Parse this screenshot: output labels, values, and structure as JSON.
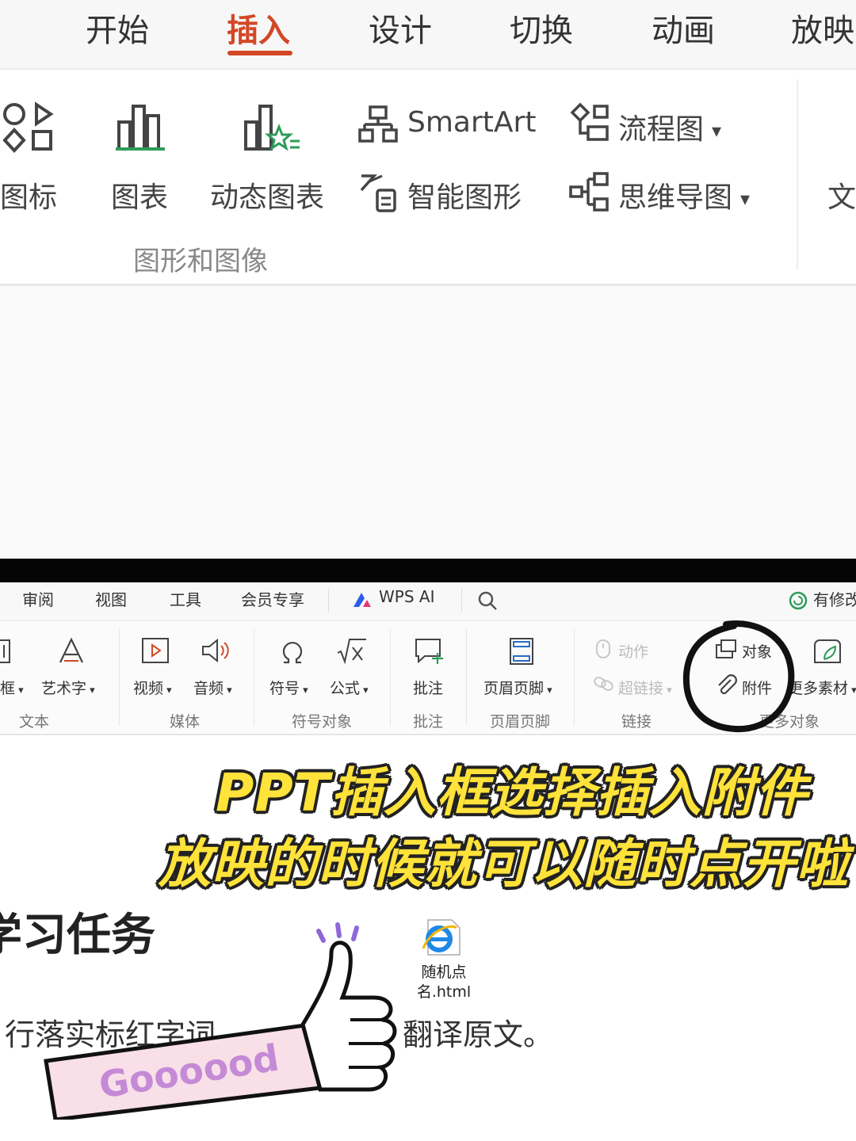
{
  "top_ribbon": {
    "tabs": [
      {
        "label": "开始"
      },
      {
        "label": "插入",
        "active": true
      },
      {
        "label": "设计"
      },
      {
        "label": "切换"
      },
      {
        "label": "动画"
      },
      {
        "label": "放映"
      }
    ],
    "items": {
      "icon_label": "图标",
      "chart_label": "图表",
      "dynamic_chart_label": "动态图表",
      "smartart_label": "SmartArt",
      "smart_shape_label": "智能图形",
      "flowchart_label": "流程图",
      "mindmap_label": "思维导图",
      "text_partial": "文"
    },
    "group_label": "图形和图像",
    "accent_color": "#d24726"
  },
  "bottom_ribbon": {
    "tabs": [
      {
        "label": "审阅"
      },
      {
        "label": "视图"
      },
      {
        "label": "工具"
      },
      {
        "label": "会员专享"
      },
      {
        "label": "WPS AI"
      }
    ],
    "revision_label": "有修改",
    "items": {
      "textbox_label": "框",
      "wordart_label": "艺术字",
      "video_label": "视频",
      "audio_label": "音频",
      "symbol_label": "符号",
      "formula_label": "公式",
      "comment_label": "批注",
      "header_footer_label": "页眉页脚",
      "action_label": "动作",
      "hyperlink_label": "超链接",
      "object_label": "对象",
      "attachment_label": "附件",
      "more_material_label": "更多素材"
    },
    "groups": {
      "text": "文本",
      "media": "媒体",
      "symbol_object": "符号对象",
      "comment": "批注",
      "header_footer": "页眉页脚",
      "link": "链接",
      "more_object": "更多对象"
    }
  },
  "caption": {
    "line1": "PPT插入框选择插入附件",
    "line2": "放映的时候就可以随时点开啦",
    "color": "#ffe23a"
  },
  "slide": {
    "title": "学习任务",
    "attachment_file": "随机点名.html",
    "line_left": "行落实标红字词",
    "line_right": "翻译原文。",
    "sticker_text": "Goooood"
  }
}
